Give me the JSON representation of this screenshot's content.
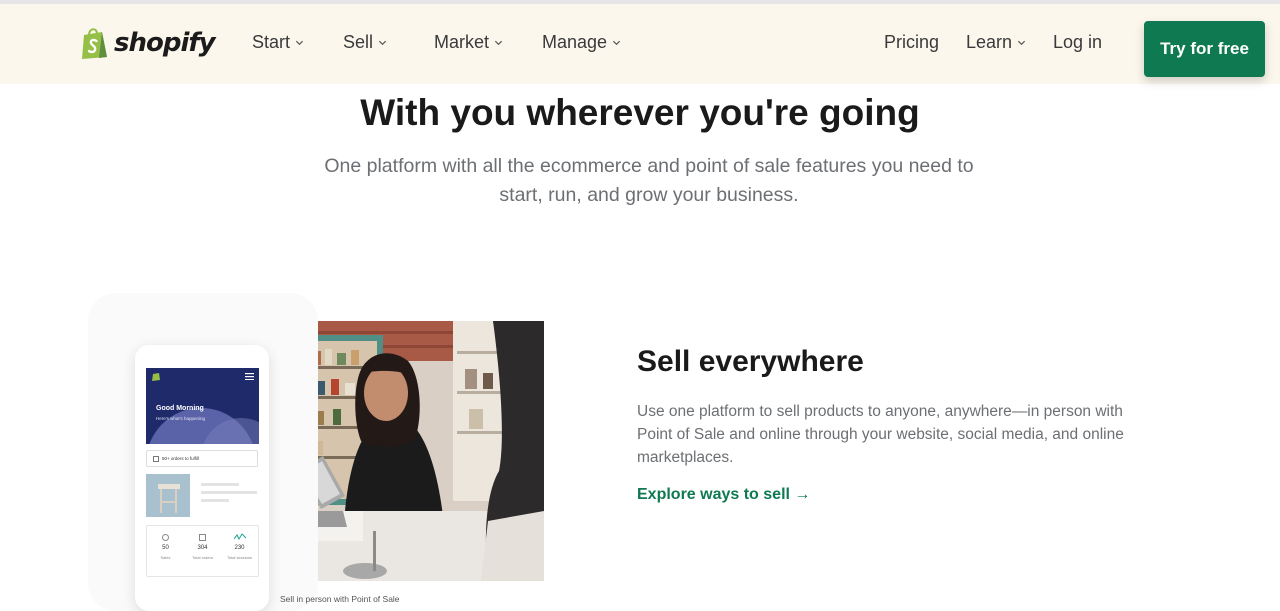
{
  "nav": {
    "logo_text": "shopify",
    "items": [
      {
        "label": "Start"
      },
      {
        "label": "Sell"
      },
      {
        "label": "Market"
      },
      {
        "label": "Manage"
      }
    ],
    "pricing": "Pricing",
    "learn": "Learn",
    "login": "Log in",
    "cta": "Try for free"
  },
  "hero": {
    "title": "With you wherever you're going",
    "subtitle": "One platform with all the ecommerce and point of sale features you need to start, run, and grow your business."
  },
  "phone": {
    "greeting": "Good Morning",
    "greeting_sub": "Here's what's happening",
    "orders_note": "50+ orders to fulfill",
    "stats": [
      {
        "value": "50",
        "label": "Sales"
      },
      {
        "value": "304",
        "label": "Total orders"
      },
      {
        "value": "230",
        "label": "Total sessions"
      }
    ]
  },
  "caption": "Sell in person with Point of Sale",
  "feature": {
    "title": "Sell everywhere",
    "body": "Use one platform to sell products to anyone, anywhere—in person with Point of Sale and online through your website, social media, and online marketplaces.",
    "link": "Explore ways to sell →"
  },
  "colors": {
    "nav_bg": "#fbf7ed",
    "brand_green": "#0f7a52",
    "logo_green": "#95bf47"
  }
}
